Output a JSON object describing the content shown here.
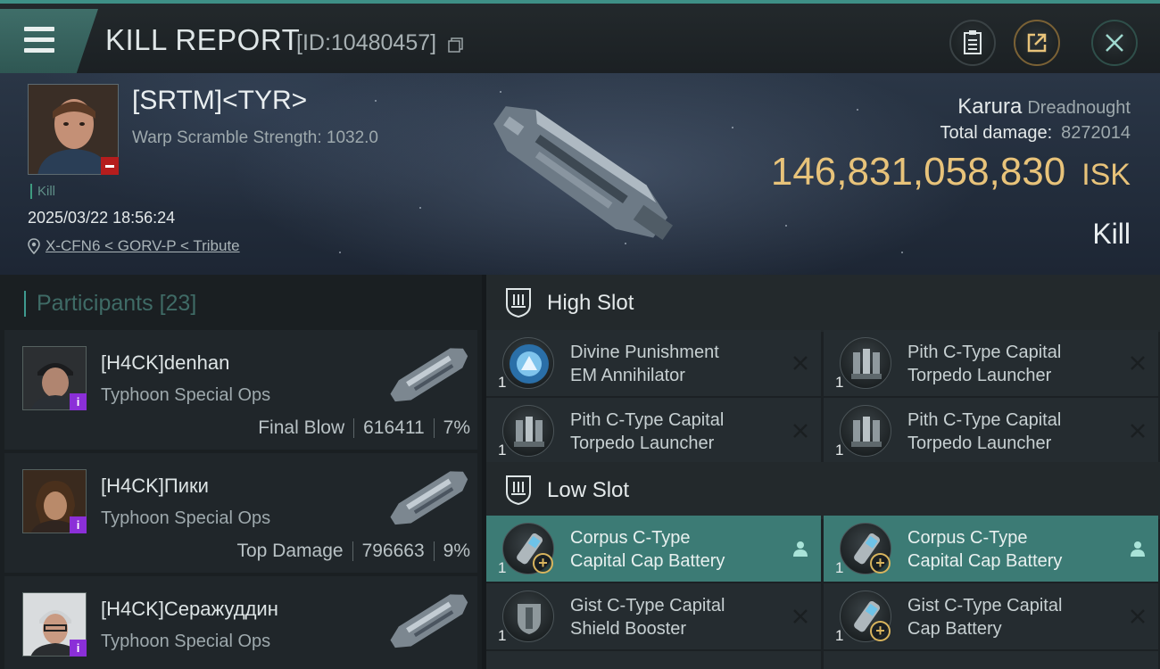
{
  "header": {
    "title": "KILL REPORT",
    "report_id": "[ID:10480457]",
    "icons": {
      "menu": "menu-icon",
      "copy": "copy-icon",
      "clipboard": "clipboard-icon",
      "share": "share-icon",
      "close": "close-icon"
    }
  },
  "victim": {
    "name": "[SRTM]<TYR>",
    "warp_scramble": "Warp Scramble Strength: 1032.0",
    "kill_tag": "Kill",
    "timestamp": "2025/03/22 18:56:24",
    "location": "X-CFN6 < GORV-P < Tribute",
    "ship_name": "Karura",
    "ship_class": "Dreadnought",
    "total_damage_label": "Total damage:",
    "total_damage": "8272014",
    "isk_value": "146,831,058,830",
    "isk_unit": "ISK",
    "result": "Kill"
  },
  "participants": {
    "label": "Participants",
    "count": "[23]",
    "items": [
      {
        "name": "[H4CK]denhan",
        "ship": "Typhoon Special Ops",
        "tag": "Final Blow",
        "damage": "616411",
        "percent": "7%",
        "badge": "i"
      },
      {
        "name": "[H4CK]Пики",
        "ship": "Typhoon Special Ops",
        "tag": "Top Damage",
        "damage": "796663",
        "percent": "9%",
        "badge": "i"
      },
      {
        "name": "[H4CK]Серажуддин",
        "ship": "Typhoon Special Ops",
        "badge": "i"
      }
    ]
  },
  "slots": {
    "high": {
      "title": "High Slot",
      "modules": [
        {
          "name_line1": "Divine Punishment",
          "name_line2": "EM Annihilator",
          "qty": "1"
        },
        {
          "name_line1": "Pith C-Type Capital",
          "name_line2": "Torpedo Launcher",
          "qty": "1"
        },
        {
          "name_line1": "Pith C-Type Capital",
          "name_line2": "Torpedo Launcher",
          "qty": "1"
        },
        {
          "name_line1": "Pith C-Type Capital",
          "name_line2": "Torpedo Launcher",
          "qty": "1"
        }
      ]
    },
    "low": {
      "title": "Low Slot",
      "modules": [
        {
          "name_line1": "Corpus C-Type",
          "name_line2": "Capital Cap Battery",
          "qty": "1"
        },
        {
          "name_line1": "Corpus C-Type",
          "name_line2": "Capital Cap Battery",
          "qty": "1"
        },
        {
          "name_line1": "Gist C-Type Capital",
          "name_line2": "Shield Booster",
          "qty": "1"
        },
        {
          "name_line1": "Gist C-Type Capital",
          "name_line2": "Cap Battery",
          "qty": "1"
        }
      ]
    }
  },
  "colors": {
    "accent": "#3e8f86",
    "isk": "#e8c37a",
    "fitted": "#3c7b75",
    "badge_purple": "#8b2fd8",
    "badge_red": "#b51d1d"
  }
}
